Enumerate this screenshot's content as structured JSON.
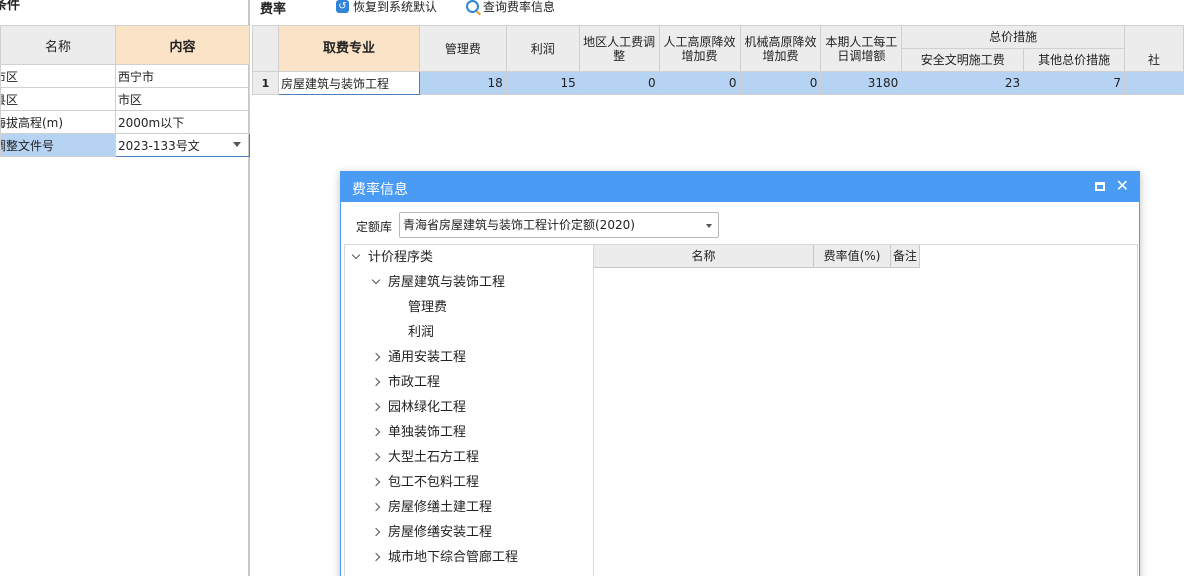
{
  "left_panel": {
    "title": "条件",
    "headers": {
      "name": "名称",
      "content": "内容"
    },
    "rows": [
      {
        "name": "市区",
        "value": "西宁市"
      },
      {
        "name": "县区",
        "value": "市区"
      },
      {
        "name": "海拔高程(m)",
        "value": "2000m以下"
      },
      {
        "name": "调整文件号",
        "value": "2023-133号文"
      }
    ]
  },
  "toolbar": {
    "title": "费率",
    "restore_label": "恢复到系统默认",
    "query_label": "查询费率信息"
  },
  "rate_grid": {
    "headers": {
      "spec": "取费专业",
      "mgmt": "管理费",
      "profit": "利润",
      "regional_adj": "地区人工费调整",
      "labor_plateau": "人工高原降效增加费",
      "machine_plateau": "机械高原降效增加费",
      "daily_wage": "本期人工每工日调增额",
      "total_measures": "总价措施",
      "safe_civil": "安全文明施工费",
      "other_measures": "其他总价措施",
      "social": "社"
    },
    "rows": [
      {
        "index": "1",
        "spec": "房屋建筑与装饰工程",
        "mgmt": "18",
        "profit": "15",
        "regional_adj": "0",
        "labor_plateau": "0",
        "machine_plateau": "0",
        "daily_wage": "3180",
        "safe_civil": "23",
        "other_measures": "7",
        "social": ""
      }
    ]
  },
  "dialog": {
    "title": "费率信息",
    "lib_label": "定额库",
    "lib_value": "青海省房屋建筑与装饰工程计价定额(2020)",
    "list_headers": {
      "name": "名称",
      "rate": "费率值(%)",
      "note": "备注"
    },
    "tree": [
      {
        "label": "计价程序类",
        "state": "expanded"
      },
      {
        "label": "房屋建筑与装饰工程",
        "state": "expanded"
      },
      {
        "label": "管理费",
        "state": "leaf"
      },
      {
        "label": "利润",
        "state": "leaf"
      },
      {
        "label": "通用安装工程",
        "state": "collapsed"
      },
      {
        "label": "市政工程",
        "state": "collapsed"
      },
      {
        "label": "园林绿化工程",
        "state": "collapsed"
      },
      {
        "label": "单独装饰工程",
        "state": "collapsed"
      },
      {
        "label": "大型土石方工程",
        "state": "collapsed"
      },
      {
        "label": "包工不包料工程",
        "state": "collapsed"
      },
      {
        "label": "房屋修缮土建工程",
        "state": "collapsed"
      },
      {
        "label": "房屋修缮安装工程",
        "state": "collapsed"
      },
      {
        "label": "城市地下综合管廊工程",
        "state": "collapsed"
      }
    ]
  },
  "colors": {
    "accent": "#4a9bf3",
    "header_highlight": "#fbe3c8",
    "row_selected": "#b7d3f3",
    "header_bg": "#ececec"
  }
}
